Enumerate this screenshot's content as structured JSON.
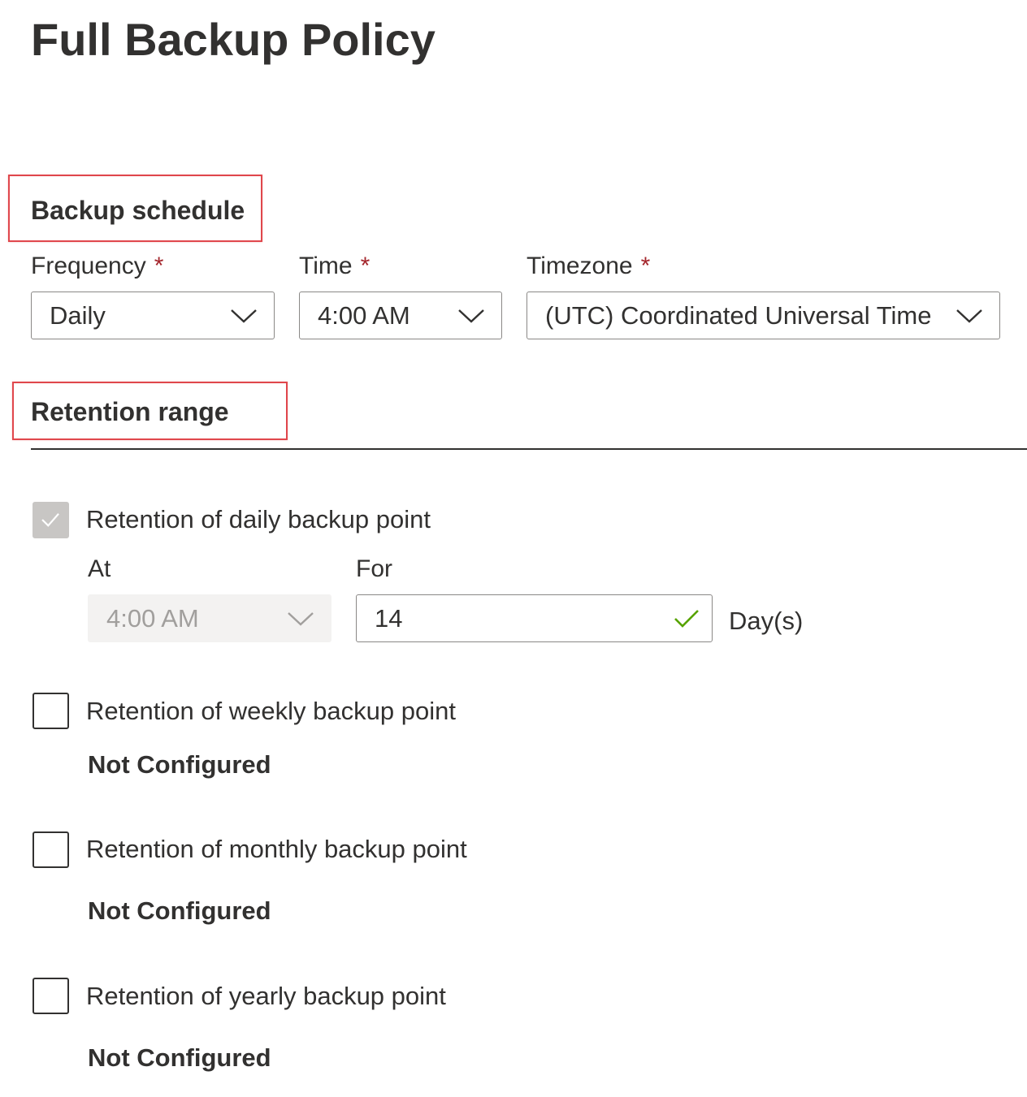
{
  "page": {
    "title": "Full Backup Policy"
  },
  "backup_schedule": {
    "heading": "Backup schedule",
    "required_marker": "*",
    "frequency": {
      "label": "Frequency",
      "value": "Daily",
      "icon": "chevron-down-icon"
    },
    "time": {
      "label": "Time",
      "value": "4:00 AM",
      "icon": "chevron-down-icon"
    },
    "timezone": {
      "label": "Timezone",
      "value": "(UTC) Coordinated Universal Time",
      "icon": "chevron-down-icon"
    }
  },
  "retention_range": {
    "heading": "Retention range",
    "daily": {
      "label": "Retention of daily backup point",
      "checked": true,
      "disabled": true,
      "at_label": "At",
      "at_value": "4:00 AM",
      "for_label": "For",
      "for_value": "14",
      "for_suffix": "Day(s)",
      "valid_icon": "checkmark-icon"
    },
    "weekly": {
      "label": "Retention of weekly backup point",
      "checked": false,
      "status": "Not Configured"
    },
    "monthly": {
      "label": "Retention of monthly backup point",
      "checked": false,
      "status": "Not Configured"
    },
    "yearly": {
      "label": "Retention of yearly backup point",
      "checked": false,
      "status": "Not Configured"
    }
  },
  "colors": {
    "text": "#323130",
    "required": "#a4262c",
    "highlight": "#e0474c",
    "valid": "#57a300",
    "disabled_bg": "#f3f2f1",
    "disabled_text": "#a19f9d"
  }
}
